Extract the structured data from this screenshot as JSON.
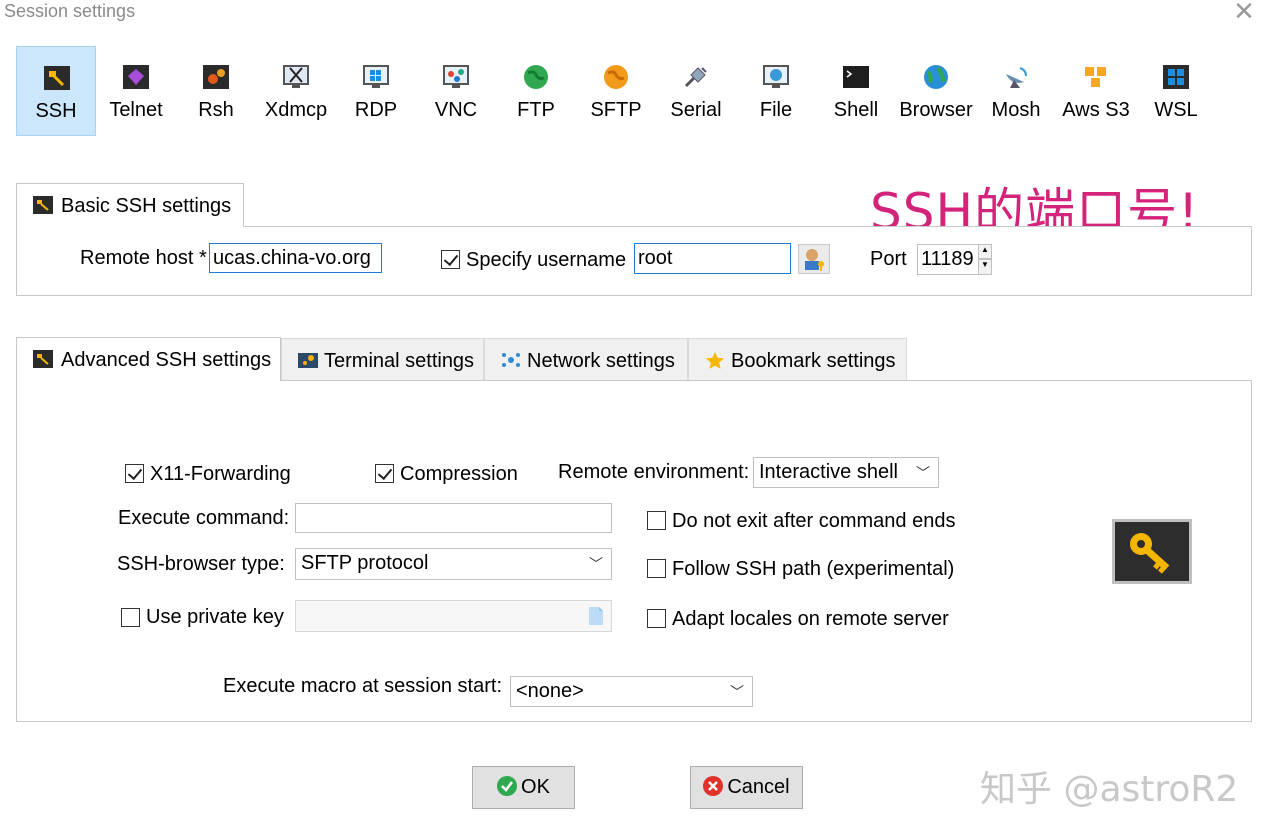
{
  "window": {
    "title": "Session settings",
    "close_glyph": "✕"
  },
  "session_types": [
    {
      "label": "SSH",
      "icon": "ssh-wrench-icon",
      "selected": true
    },
    {
      "label": "Telnet",
      "icon": "telnet-gem-icon"
    },
    {
      "label": "Rsh",
      "icon": "rsh-gears-icon"
    },
    {
      "label": "Xdmcp",
      "icon": "xdmcp-monitor-icon"
    },
    {
      "label": "RDP",
      "icon": "rdp-windows-monitor-icon"
    },
    {
      "label": "VNC",
      "icon": "vnc-monitor-icon"
    },
    {
      "label": "FTP",
      "icon": "ftp-globe-icon"
    },
    {
      "label": "SFTP",
      "icon": "sftp-globe-icon"
    },
    {
      "label": "Serial",
      "icon": "serial-plug-icon"
    },
    {
      "label": "File",
      "icon": "file-monitor-icon"
    },
    {
      "label": "Shell",
      "icon": "shell-terminal-icon"
    },
    {
      "label": "Browser",
      "icon": "browser-globe-icon"
    },
    {
      "label": "Mosh",
      "icon": "mosh-satellite-icon"
    },
    {
      "label": "Aws S3",
      "icon": "aws-s3-cubes-icon"
    },
    {
      "label": "WSL",
      "icon": "wsl-windows-icon"
    }
  ],
  "annotation": "SSH的端口号!",
  "basic": {
    "tab_label": "Basic SSH settings",
    "remote_host_label": "Remote host *",
    "remote_host_value": "ucas.china-vo.org",
    "specify_username_label": "Specify username",
    "specify_username_checked": true,
    "username_value": "root",
    "port_label": "Port",
    "port_value": "11189"
  },
  "tabs": [
    {
      "label": "Advanced SSH settings",
      "icon": "wrench-icon",
      "active": true
    },
    {
      "label": "Terminal settings",
      "icon": "terminal-settings-icon"
    },
    {
      "label": "Network settings",
      "icon": "network-dots-icon"
    },
    {
      "label": "Bookmark settings",
      "icon": "star-icon"
    }
  ],
  "advanced": {
    "x11_label": "X11-Forwarding",
    "x11_checked": true,
    "compression_label": "Compression",
    "compression_checked": true,
    "remote_env_label": "Remote environment:",
    "remote_env_value": "Interactive shell",
    "execute_command_label": "Execute command:",
    "execute_command_value": "",
    "do_not_exit_label": "Do not exit after command ends",
    "ssh_browser_label": "SSH-browser type:",
    "ssh_browser_value": "SFTP protocol",
    "follow_path_label": "Follow SSH path (experimental)",
    "private_key_label": "Use private key",
    "adapt_locales_label": "Adapt locales on remote server",
    "macro_label": "Execute macro at session start:",
    "macro_value": "<none>"
  },
  "buttons": {
    "ok": "OK",
    "cancel": "Cancel"
  },
  "watermark": "知乎 @astroR2",
  "colors": {
    "selected_bg": "#cce6fb",
    "annotation": "#d4237a",
    "focus_border": "#1f7ad6"
  }
}
